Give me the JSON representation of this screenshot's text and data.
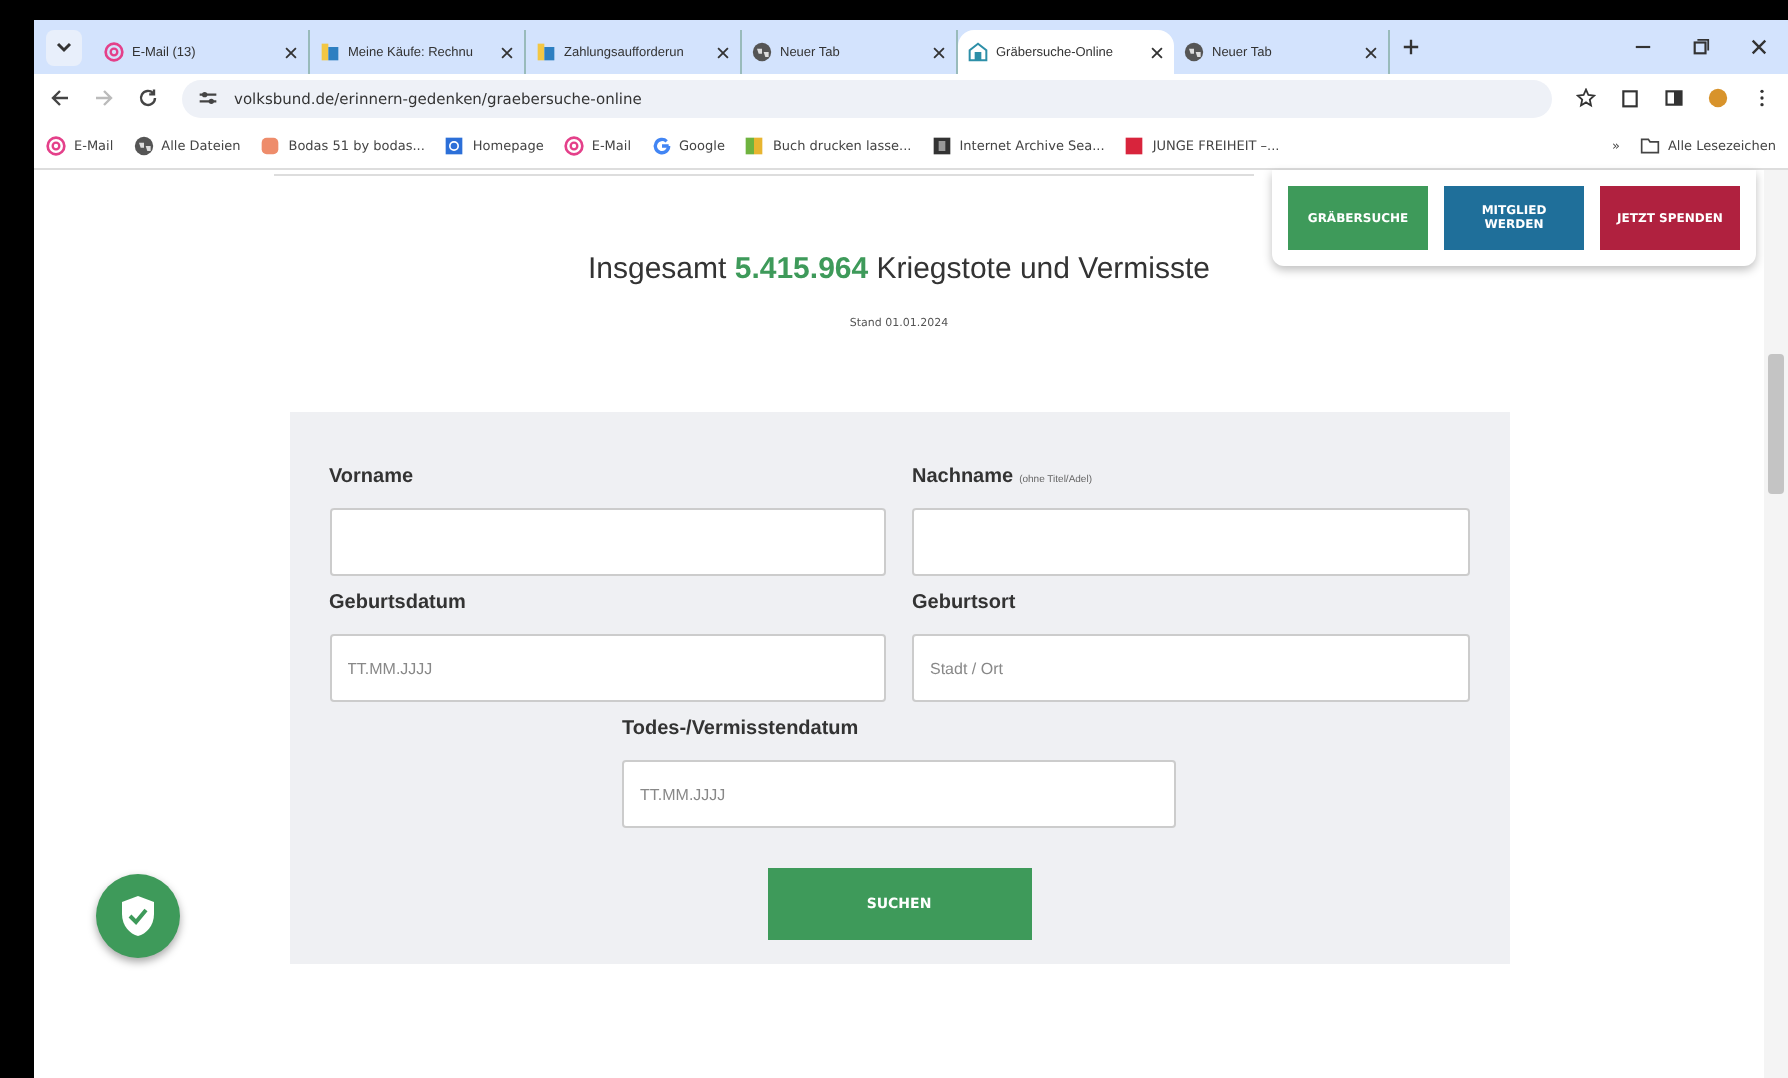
{
  "tabs": [
    {
      "label": "E-Mail (13)",
      "selected": false
    },
    {
      "label": "Meine Käufe: Rechnu",
      "selected": false
    },
    {
      "label": "Zahlungsaufforderun",
      "selected": false
    },
    {
      "label": "Neuer Tab",
      "selected": false
    },
    {
      "label": "Gräbersuche-Online",
      "selected": true
    },
    {
      "label": "Neuer Tab",
      "selected": false
    }
  ],
  "address": {
    "url": "volksbund.de/erinnern-gedenken/graebersuche-online"
  },
  "bookmarks": [
    {
      "label": "E-Mail"
    },
    {
      "label": "Alle Dateien"
    },
    {
      "label": "Bodas 51 by bodas..."
    },
    {
      "label": "Homepage"
    },
    {
      "label": "E-Mail"
    },
    {
      "label": "Google"
    },
    {
      "label": "Buch drucken lasse..."
    },
    {
      "label": "Internet Archive Sea..."
    },
    {
      "label": "JUNGE FREIHEIT –..."
    }
  ],
  "bookmarks_overflow": "»",
  "all_bookmarks": "Alle Lesezeichen",
  "header_buttons": [
    {
      "label": "GRÄBERSUCHE",
      "color": "#3e9a5a"
    },
    {
      "label": "MITGLIED WERDEN",
      "color": "#1f6f9a"
    },
    {
      "label": "JETZT SPENDEN",
      "color": "#b0213f"
    }
  ],
  "headline": "Insgesamt **5.415.964** Kriegstote und Vermisste",
  "date_note": "Stand 01.01.2024",
  "form": {
    "fields": [
      {
        "label": "Vorname"
      },
      {
        "label": "Nachname",
        "hint": "(ohne Titel/Adel)"
      },
      {
        "label": "Geburtsdatum",
        "placeholder": "TT.MM.JJJJ"
      },
      {
        "label": "Geburtsort",
        "placeholder": "Stadt / Ort"
      },
      {
        "label": "Todes-/Vermisstendatum",
        "placeholder": "TT.MM.JJJJ"
      }
    ],
    "submit": "SUCHEN"
  }
}
